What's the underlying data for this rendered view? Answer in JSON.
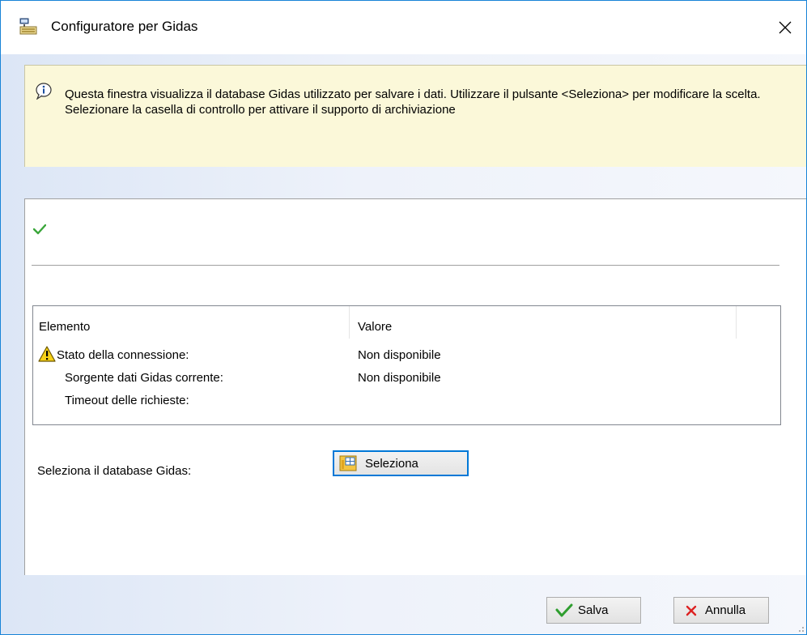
{
  "window": {
    "title": "Configuratore per Gidas",
    "app_icon": "database-config-icon",
    "close_icon": "close-icon"
  },
  "info": {
    "icon": "info-balloon-icon",
    "text": "Questa finestra visualizza il database Gidas utilizzato per salvare i dati. Utilizzare il pulsante <Seleziona> per modificare la scelta. Selezionare la casella di controllo per attivare il supporto di archiviazione"
  },
  "status": {
    "icon": "green-check-icon"
  },
  "properties": {
    "columns": [
      "Elemento",
      "Valore"
    ],
    "rows": [
      {
        "icon": "warning-icon",
        "name": "Stato della connessione:",
        "value": "Non disponibile"
      },
      {
        "icon": "",
        "name": "Sorgente dati Gidas corrente:",
        "value": "Non disponibile"
      },
      {
        "icon": "",
        "name": "Timeout delle richieste:",
        "value": ""
      }
    ]
  },
  "select": {
    "label": "Seleziona il database Gidas:",
    "button_label": "Seleziona",
    "button_icon": "select-database-icon"
  },
  "footer": {
    "save_label": "Salva",
    "save_icon": "green-check-icon",
    "cancel_label": "Annulla",
    "cancel_icon": "red-x-icon"
  },
  "colors": {
    "accent": "#0078d7",
    "info_background": "#fbf8d9",
    "client_gradient_start": "#dce6f6"
  }
}
